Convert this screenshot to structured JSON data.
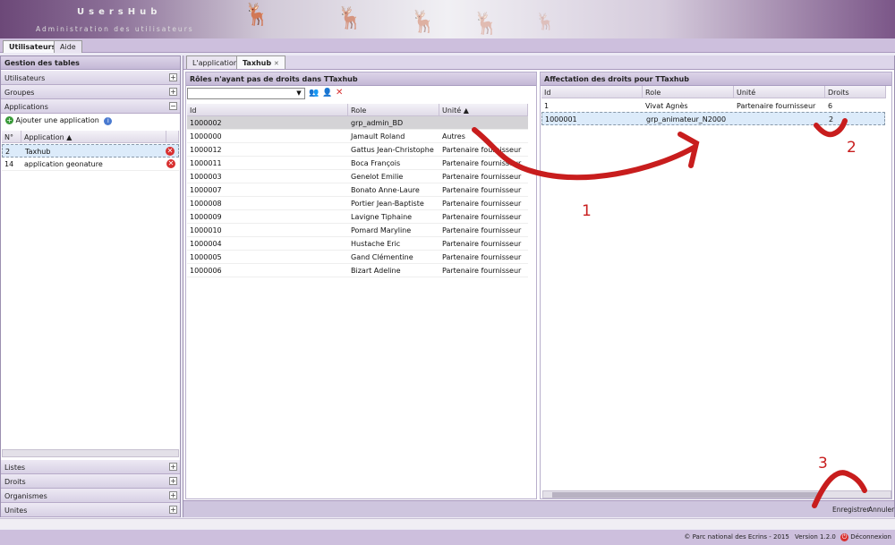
{
  "header": {
    "title": "UsersHub",
    "subtitle": "Administration des utilisateurs"
  },
  "top_tabs": [
    {
      "label": "Utilisateurs"
    },
    {
      "label": "Aide"
    }
  ],
  "left": {
    "title": "Gestion des tables",
    "accordions_top": [
      "Utilisateurs",
      "Groupes",
      "Applications"
    ],
    "add_app": "Ajouter une application",
    "table": {
      "headers": [
        "N°",
        "Application"
      ],
      "rows": [
        {
          "n": "2",
          "app": "Taxhub"
        },
        {
          "n": "14",
          "app": "application geonature"
        }
      ]
    },
    "accordions_bottom": [
      "Listes",
      "Droits",
      "Organismes",
      "Unites"
    ]
  },
  "center_tabs": [
    {
      "label": "L'application"
    },
    {
      "label": "Taxhub"
    }
  ],
  "roles_panel": {
    "title": "Rôles n'ayant pas de droits dans TTaxhub",
    "headers": [
      "Id",
      "Role",
      "Unité"
    ],
    "rows": [
      {
        "id": "1000002",
        "role": "grp_admin_BD",
        "unite": ""
      },
      {
        "id": "1000000",
        "role": "Jamault Roland",
        "unite": "Autres"
      },
      {
        "id": "1000012",
        "role": "Gattus Jean-Christophe",
        "unite": "Partenaire fournisseur"
      },
      {
        "id": "1000011",
        "role": "Boca François",
        "unite": "Partenaire fournisseur"
      },
      {
        "id": "1000003",
        "role": "Genelot Emilie",
        "unite": "Partenaire fournisseur"
      },
      {
        "id": "1000007",
        "role": "Bonato Anne-Laure",
        "unite": "Partenaire fournisseur"
      },
      {
        "id": "1000008",
        "role": "Portier Jean-Baptiste",
        "unite": "Partenaire fournisseur"
      },
      {
        "id": "1000009",
        "role": "Lavigne Tiphaine",
        "unite": "Partenaire fournisseur"
      },
      {
        "id": "1000010",
        "role": "Pomard Maryline",
        "unite": "Partenaire fournisseur"
      },
      {
        "id": "1000004",
        "role": "Hustache Eric",
        "unite": "Partenaire fournisseur"
      },
      {
        "id": "1000005",
        "role": "Gand Clémentine",
        "unite": "Partenaire fournisseur"
      },
      {
        "id": "1000006",
        "role": "Bizart Adeline",
        "unite": "Partenaire fournisseur"
      }
    ]
  },
  "rights_panel": {
    "title": "Affectation des droits pour TTaxhub",
    "headers": [
      "Id",
      "Role",
      "Unité",
      "Droits"
    ],
    "rows": [
      {
        "id": "1",
        "role": "Vivat Agnès",
        "unite": "Partenaire fournisseur",
        "droits": "6"
      },
      {
        "id": "1000001",
        "role": "grp_animateur_N2000",
        "unite": "",
        "droits": "2"
      }
    ]
  },
  "actions": {
    "save": "Enregistrer",
    "cancel": "Annuler"
  },
  "annotations": [
    "1",
    "2",
    "3"
  ],
  "footer": {
    "copyright": "© Parc national des Ecrins - 2015",
    "version": "Version 1.2.0",
    "logout": "Déconnexion"
  },
  "colors": {
    "accent": "#7b5688",
    "annotation": "#c81d1d"
  }
}
